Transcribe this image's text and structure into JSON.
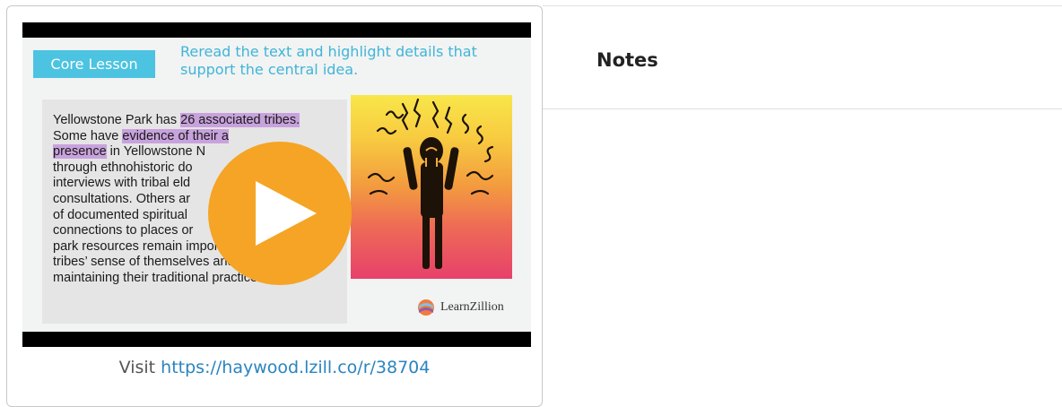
{
  "video": {
    "slide": {
      "tag": "Core Lesson",
      "instruction": "Reread the text and highlight details that support the central idea.",
      "passage": {
        "p1": "Yellowstone Park has ",
        "hl1": "26 associated tribes.",
        "p2": " Some have ",
        "hl2": "evidence of their a",
        "hl3": "presence",
        "p3": " in Yellowstone N",
        "p4": " through ethnohistoric do",
        "p5": " interviews with tribal eld",
        "p6": " consultations. Others ar",
        "p7": " of documented spiritual",
        "p8": " connections to places or",
        "p9": " park resources remain impor",
        "p10": " tribes’ sense of themselves and in",
        "p11": " maintaining their traditional practices."
      },
      "logo_text": "LearnZillion"
    },
    "play_icon": "play-icon",
    "play_color": "#f5a425"
  },
  "visit": {
    "prefix": "Visit ",
    "link": "https://haywood.lzill.co/r/38704"
  },
  "notes": {
    "title": "Notes"
  }
}
